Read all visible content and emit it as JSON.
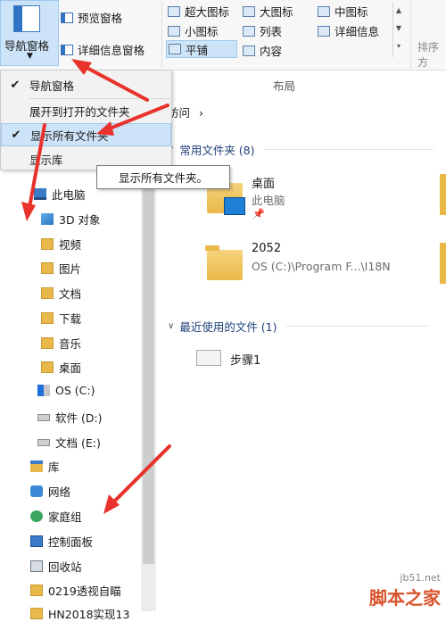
{
  "ribbon": {
    "nav_pane_label": "导航窗格",
    "preview_pane_label": "预览窗格",
    "details_pane_label": "详细信息窗格",
    "layout_items": [
      "超大图标",
      "大图标",
      "中图标",
      "小图标",
      "列表",
      "详细信息",
      "平铺",
      "内容"
    ],
    "layout_group_label": "布局",
    "sort_label": "排序方"
  },
  "nav_menu": {
    "items": [
      {
        "label": "导航窗格",
        "checked": true
      },
      {
        "label": "展开到打开的文件夹",
        "checked": false
      },
      {
        "label": "显示所有文件夹",
        "checked": true
      },
      {
        "label": "显示库",
        "checked": false
      }
    ],
    "tooltip": "显示所有文件夹。"
  },
  "nav_tree": [
    {
      "label": "此电脑",
      "icon": "pc-icon"
    },
    {
      "label": "3D 对象",
      "icon": "3d-objects-icon"
    },
    {
      "label": "视频",
      "icon": "videos-icon"
    },
    {
      "label": "图片",
      "icon": "pictures-icon"
    },
    {
      "label": "文档",
      "icon": "documents-icon"
    },
    {
      "label": "下载",
      "icon": "downloads-icon"
    },
    {
      "label": "音乐",
      "icon": "music-icon"
    },
    {
      "label": "桌面",
      "icon": "desktop-icon"
    },
    {
      "label": "OS (C:)",
      "icon": "os-drive-icon"
    },
    {
      "label": "软件 (D:)",
      "icon": "drive-icon"
    },
    {
      "label": "文档 (E:)",
      "icon": "drive-icon"
    },
    {
      "label": "库",
      "icon": "library-icon"
    },
    {
      "label": "网络",
      "icon": "network-icon"
    },
    {
      "label": "家庭组",
      "icon": "homegroup-icon"
    },
    {
      "label": "控制面板",
      "icon": "control-panel-icon"
    },
    {
      "label": "回收站",
      "icon": "recycle-bin-icon"
    },
    {
      "label": "0219透视自瞄",
      "icon": "folder-icon"
    },
    {
      "label": "HN2018实现13",
      "icon": "folder-icon"
    }
  ],
  "main": {
    "address_fragment": "访问",
    "frequent_header": "常用文件夹 (8)",
    "recent_header": "最近使用的文件 (1)",
    "frequent_items": [
      {
        "name": "桌面",
        "sub": "此电脑"
      },
      {
        "name": "2052",
        "sub": "OS (C:)\\Program F...\\I18N"
      }
    ],
    "recent_items": [
      {
        "name": "步骤1"
      }
    ]
  },
  "watermark": {
    "url": "jb51.net",
    "text": "脚本之家"
  }
}
